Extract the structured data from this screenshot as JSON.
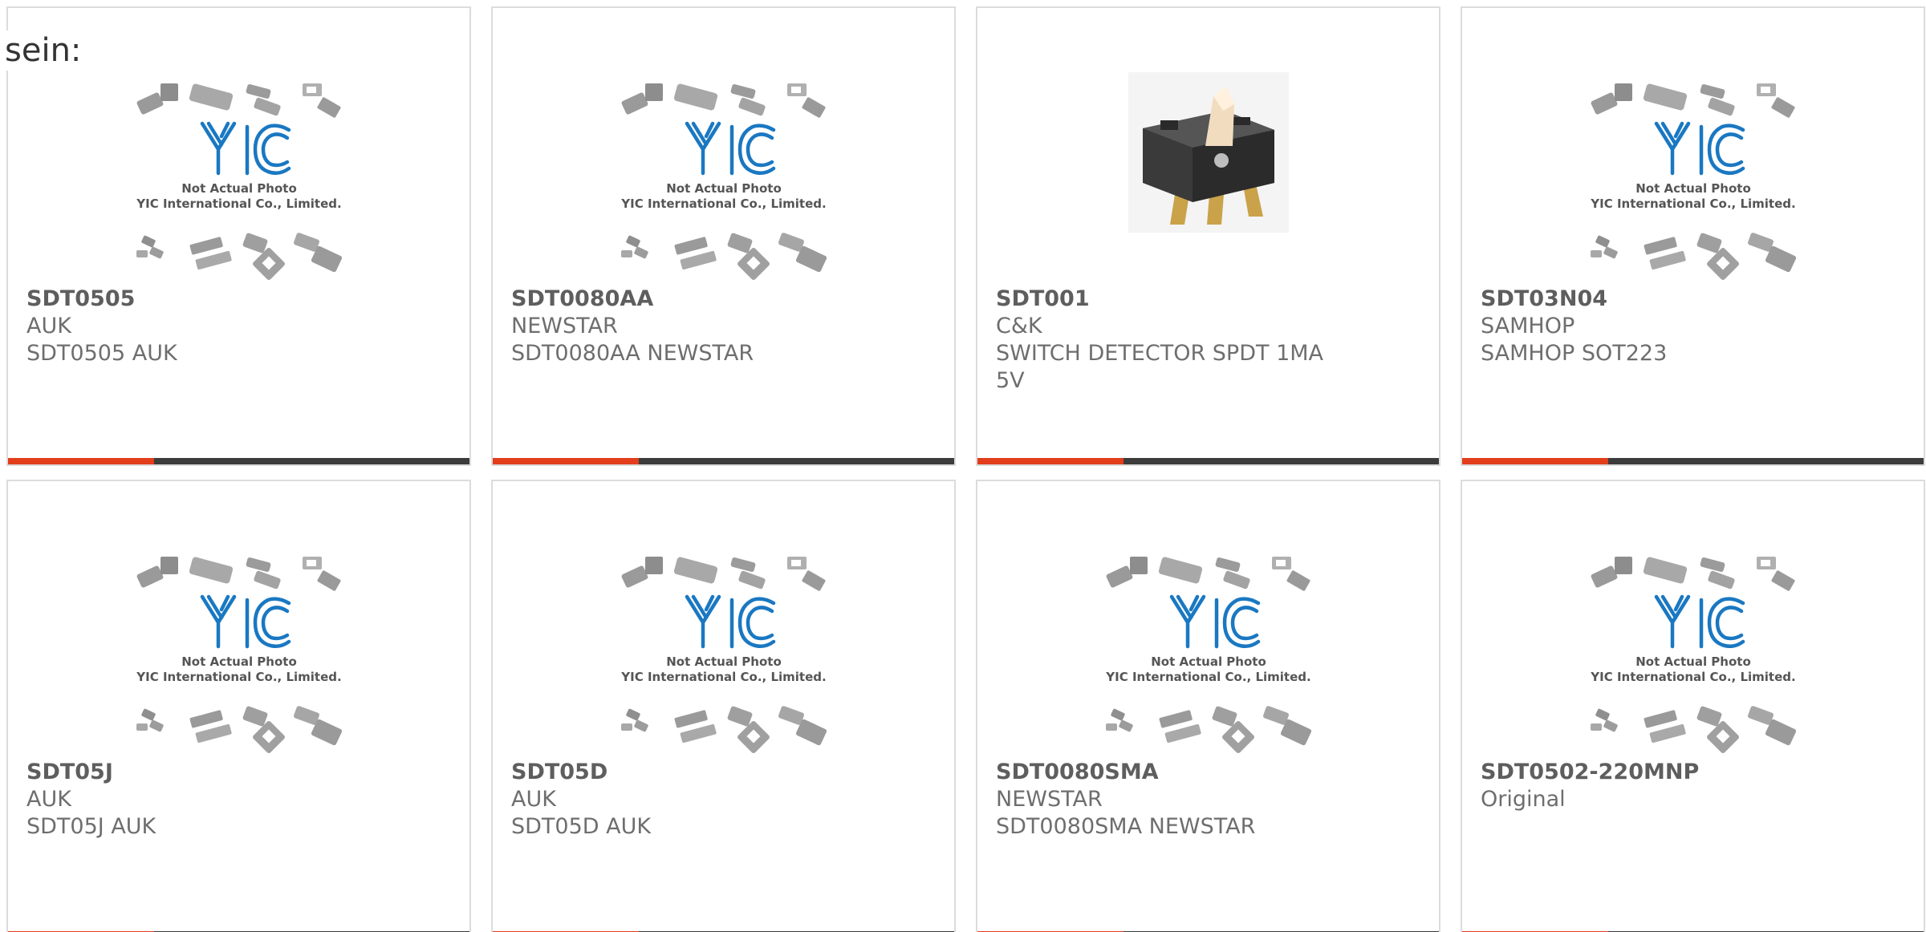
{
  "page": {
    "heading": "sein:"
  },
  "theme": {
    "accent": "#e23e1c",
    "bar": "#3c3c3c",
    "border": "#dcdcdc"
  },
  "placeholder": {
    "caption_line1": "Not Actual Photo",
    "caption_line2": "YIC International Co., Limited.",
    "logo_text": "YIC"
  },
  "products": [
    {
      "part": "SDT0505",
      "brand": "AUK",
      "desc": "SDT0505 AUK",
      "image": "placeholder"
    },
    {
      "part": "SDT0080AA",
      "brand": "NEWSTAR",
      "desc": "SDT0080AA NEWSTAR",
      "image": "placeholder"
    },
    {
      "part": "SDT001",
      "brand": "C&K",
      "desc": "SWITCH DETECTOR SPDT 1MA",
      "desc2": "5V",
      "image": "photo"
    },
    {
      "part": "SDT03N04",
      "brand": "SAMHOP",
      "desc": "SAMHOP SOT223",
      "image": "placeholder"
    },
    {
      "part": "SDT05J",
      "brand": "AUK",
      "desc": "SDT05J AUK",
      "image": "placeholder"
    },
    {
      "part": "SDT05D",
      "brand": "AUK",
      "desc": "SDT05D AUK",
      "image": "placeholder"
    },
    {
      "part": "SDT0080SMA",
      "brand": "NEWSTAR",
      "desc": "SDT0080SMA NEWSTAR",
      "image": "placeholder"
    },
    {
      "part": "SDT0502-220MNP",
      "brand": "Original",
      "image": "placeholder"
    }
  ]
}
